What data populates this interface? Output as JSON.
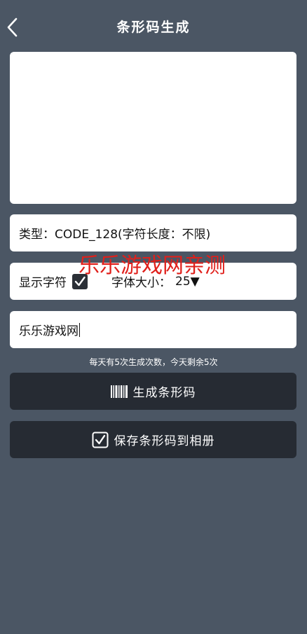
{
  "header": {
    "title": "条形码生成",
    "back_icon": "chevron-left-icon"
  },
  "type_row": {
    "label": "类型：",
    "value": "CODE_128(字符长度：不限)"
  },
  "options_row": {
    "show_text_label": "显示字符",
    "show_text_checked": true,
    "font_size_label": "字体大小：",
    "font_size_value": "25",
    "dropdown_glyph": "▼"
  },
  "input": {
    "value": "乐乐游戏网"
  },
  "quota": {
    "text": "每天有5次生成次数，今天剩余5次"
  },
  "generate_button": {
    "label": "生成条形码",
    "icon": "barcode-icon"
  },
  "save_button": {
    "label": "保存条形码到相册",
    "icon": "checkbox-icon"
  },
  "watermark": {
    "text": "乐乐游戏网亲测"
  },
  "colors": {
    "background": "#4b5664",
    "button": "#262b33",
    "card": "#ffffff",
    "watermark": "#e0201b"
  }
}
